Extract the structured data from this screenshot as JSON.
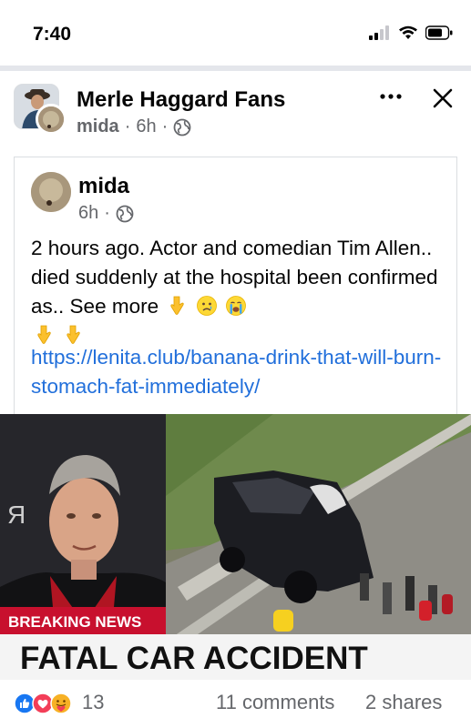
{
  "status_bar": {
    "time": "7:40",
    "icons": [
      "signal-icon",
      "wifi-icon",
      "battery-icon"
    ]
  },
  "post": {
    "page_name": "Merle Haggard Fans",
    "author": "mida",
    "time": "6h",
    "separator": "·",
    "audience_icon": "globe-icon",
    "actions": [
      "more-options-icon",
      "close-icon"
    ]
  },
  "shared_post": {
    "author": "mida",
    "time": "6h",
    "separator": "·",
    "text": "2 hours ago. Actor and comedian Tim Allen..  died suddenly at the hospital been confirmed as..",
    "see_more": "See more",
    "emojis": [
      "pointing-down-emoji",
      "crying-face-emoji",
      "loudly-crying-face-emoji",
      "pointing-down-emoji",
      "pointing-down-emoji"
    ],
    "link": "https://lenita.club/banana-drink-that-will-burn-stomach-fat-immediately/"
  },
  "image": {
    "ticker_label": "BREAKING NEWS",
    "headline": "FATAL CAR ACCIDENT",
    "side_letter": "Я"
  },
  "engagement": {
    "reactions": [
      "like-icon",
      "love-icon",
      "care-icon"
    ],
    "reaction_count": "13",
    "comments": "11 comments",
    "shares": "2 shares"
  },
  "colors": {
    "link": "#216fdb",
    "meta_gray": "#65676b",
    "like_blue": "#1877f2",
    "love_red": "#f33e58",
    "care_yellow": "#f7b125",
    "ticker_red": "#c8102e"
  }
}
